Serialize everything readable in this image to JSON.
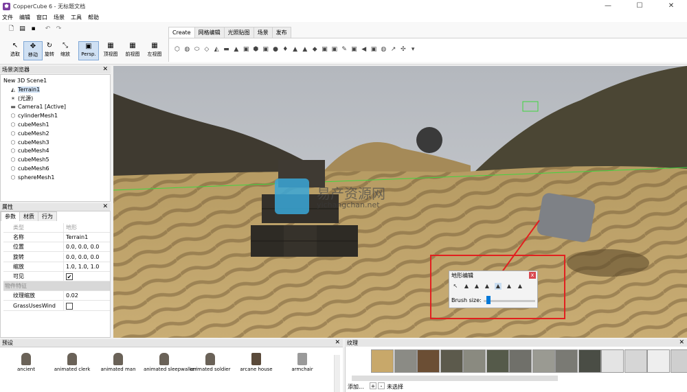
{
  "window": {
    "title": "CopperCube 6 - 无标题文档",
    "app_icon": "coppercube-icon",
    "minimize": "—",
    "maximize": "☐",
    "close": "✕"
  },
  "menu": [
    "文件",
    "编辑",
    "窗口",
    "场景",
    "工具",
    "帮助"
  ],
  "quick_access": [
    "new-icon",
    "open-icon",
    "save-icon",
    "save-as-icon",
    "undo-icon",
    "redo-icon"
  ],
  "tools": [
    {
      "label": "选取",
      "icon": "↖"
    },
    {
      "label": "移动",
      "icon": "✥"
    },
    {
      "label": "旋转",
      "icon": "↻"
    },
    {
      "label": "缩放",
      "icon": "⤡"
    },
    {
      "label": "Persp.",
      "icon": "▣"
    },
    {
      "label": "顶视图",
      "icon": "▦"
    },
    {
      "label": "前视图",
      "icon": "▦"
    },
    {
      "label": "左视图",
      "icon": "▦"
    }
  ],
  "ribbon_tabs": [
    "Create",
    "网格编辑",
    "光照贴图",
    "场景",
    "发布"
  ],
  "ribbon_icons": [
    "⬡",
    "◍",
    "⬭",
    "◇",
    "◭",
    "▬",
    "▲",
    "▣",
    "⬢",
    "▣",
    "●",
    "♦",
    "▲",
    "▲",
    "◆",
    "▣",
    "▣",
    "✎",
    "▣",
    "◀",
    "▣",
    "◍",
    "↗",
    "✣",
    "▾"
  ],
  "scene_browser": {
    "title": "场景浏览器",
    "close": "✕",
    "items": [
      {
        "label": "New 3D Scene1",
        "icon": "",
        "level": 0
      },
      {
        "label": "Terrain1",
        "icon": "◭",
        "level": 1
      },
      {
        "label": "(光源)",
        "icon": "✶",
        "level": 1
      },
      {
        "label": "Camera1 [Active]",
        "icon": "▬",
        "level": 1
      },
      {
        "label": "cylinderMesh1",
        "icon": "⬡",
        "level": 1
      },
      {
        "label": "cubeMesh1",
        "icon": "⬡",
        "level": 1
      },
      {
        "label": "cubeMesh2",
        "icon": "⬡",
        "level": 1
      },
      {
        "label": "cubeMesh3",
        "icon": "⬡",
        "level": 1
      },
      {
        "label": "cubeMesh4",
        "icon": "⬡",
        "level": 1
      },
      {
        "label": "cubeMesh5",
        "icon": "⬡",
        "level": 1
      },
      {
        "label": "cubeMesh6",
        "icon": "⬡",
        "level": 1
      },
      {
        "label": "sphereMesh1",
        "icon": "⬡",
        "level": 1
      }
    ]
  },
  "properties": {
    "title": "属性",
    "close": "✕",
    "tabs": [
      "参数",
      "材质",
      "行为"
    ],
    "rows": [
      {
        "key": "类型",
        "value": "地形",
        "style": "grey"
      },
      {
        "key": "名称",
        "value": "Terrain1",
        "style": ""
      },
      {
        "key": "位置",
        "value": "0.0, 0.0, 0.0",
        "style": ""
      },
      {
        "key": "旋转",
        "value": "0.0, 0.0, 0.0",
        "style": ""
      },
      {
        "key": "缩放",
        "value": "1.0, 1.0, 1.0",
        "style": ""
      },
      {
        "key": "可见",
        "value": "✔",
        "style": "check"
      },
      {
        "key": "物件特征",
        "value": "",
        "style": "section"
      },
      {
        "key": "纹理缩放",
        "value": "0.02",
        "style": ""
      },
      {
        "key": "GrassUsesWind",
        "value": "",
        "style": "check"
      }
    ]
  },
  "terrain_editor": {
    "title": "地形编辑",
    "close": "x",
    "brush_label": "Brush size:",
    "brush_value": 0.05,
    "tool_icons": [
      "↖",
      "▲",
      "▲",
      "▲",
      "▲",
      "▲",
      "▲"
    ]
  },
  "watermark": {
    "line1": "易产资源网",
    "line2": "yichangchan.net"
  },
  "presets": {
    "title": "预设",
    "close": "✕",
    "items": [
      "ancient",
      "animated clerk",
      "animated man",
      "animated sleepwalker",
      "animated soldier",
      "arcane house",
      "armchair"
    ]
  },
  "textures": {
    "title": "纹理",
    "close": "✕",
    "add_label": "添加...",
    "plus": "+",
    "minus": "-",
    "status": "未选择",
    "colors": [
      "#c8a86a",
      "#8b8b85",
      "#6b4e34",
      "#5c5a4c",
      "#8a8a80",
      "#555a4a",
      "#70706a",
      "#9a9a92",
      "#7a7a74",
      "#4a4d45",
      "#e4e4e4",
      "#d6d6d6",
      "#eeeeee",
      "#cfcfcf"
    ]
  },
  "colors": {
    "accent": "#0078d7",
    "highlight": "#e21f1f",
    "green_line": "#3fd63f"
  }
}
